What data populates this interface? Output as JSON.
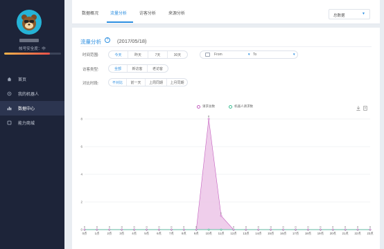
{
  "sidebar": {
    "security_text": "帐号安全度：中",
    "security_level_percent": 80,
    "items": [
      {
        "label": "首页",
        "icon": "home-icon",
        "active": false
      },
      {
        "label": "我的机器人",
        "icon": "robot-icon",
        "active": false
      },
      {
        "label": "数据中心",
        "icon": "chart-icon",
        "active": true
      },
      {
        "label": "能力商城",
        "icon": "store-icon",
        "active": false
      }
    ]
  },
  "topbar": {
    "tabs": [
      "数据概况",
      "流量分析",
      "访客分析",
      "来源分析"
    ],
    "active_tab": 1,
    "dataset_select": "总数据"
  },
  "panel": {
    "title": "流量分析",
    "help_glyph": "?",
    "date": "(2017/05/18)"
  },
  "filters": {
    "time_label": "时间范围:",
    "time_options": [
      "今天",
      "昨天",
      "7天",
      "30天"
    ],
    "time_active": 0,
    "range_from": "From",
    "range_to": "To",
    "visitor_label": "访客类型:",
    "visitor_options": [
      "全部",
      "新访客",
      "老访客"
    ],
    "visitor_active": 0,
    "compare_label": "对比时段:",
    "compare_options": [
      "不对比",
      "前一天",
      "上周同期",
      "上月同期"
    ],
    "compare_active": 0
  },
  "chart_data": {
    "type": "area",
    "x": [
      "0点",
      "1点",
      "2点",
      "3点",
      "4点",
      "5点",
      "6点",
      "7点",
      "8点",
      "9点",
      "10点",
      "11点",
      "12点",
      "13点",
      "14点",
      "15点",
      "16点",
      "17点",
      "18点",
      "19点",
      "20点",
      "21点",
      "22点",
      "23点"
    ],
    "series": [
      {
        "name": "请求总数",
        "values": [
          0,
          0,
          0,
          0,
          0,
          0,
          0,
          0,
          0,
          0,
          8,
          1,
          0,
          0,
          0,
          0,
          0,
          0,
          0,
          0,
          0,
          0,
          0,
          0
        ],
        "color": "#c45fbf",
        "fill": "#ecc5e8"
      },
      {
        "name": "机器人请求数",
        "values": [
          0,
          0,
          0,
          0,
          0,
          0,
          0,
          0,
          0,
          0,
          0,
          0,
          0,
          0,
          0,
          0,
          0,
          0,
          0,
          0,
          0,
          0,
          0,
          0
        ],
        "color": "#3bbf93"
      }
    ],
    "point_labels": [
      "0",
      "0",
      "0",
      "0",
      "0",
      "0",
      "0",
      "0",
      "0",
      "0",
      "8",
      "1",
      "0",
      "0",
      "0",
      "0",
      "0",
      "0",
      "0",
      "0",
      "0",
      "0",
      "0",
      "0"
    ],
    "yticks": [
      0,
      2,
      4,
      6,
      8
    ],
    "ylim": [
      0,
      8
    ],
    "grid": true,
    "legend_position": "top-center"
  }
}
